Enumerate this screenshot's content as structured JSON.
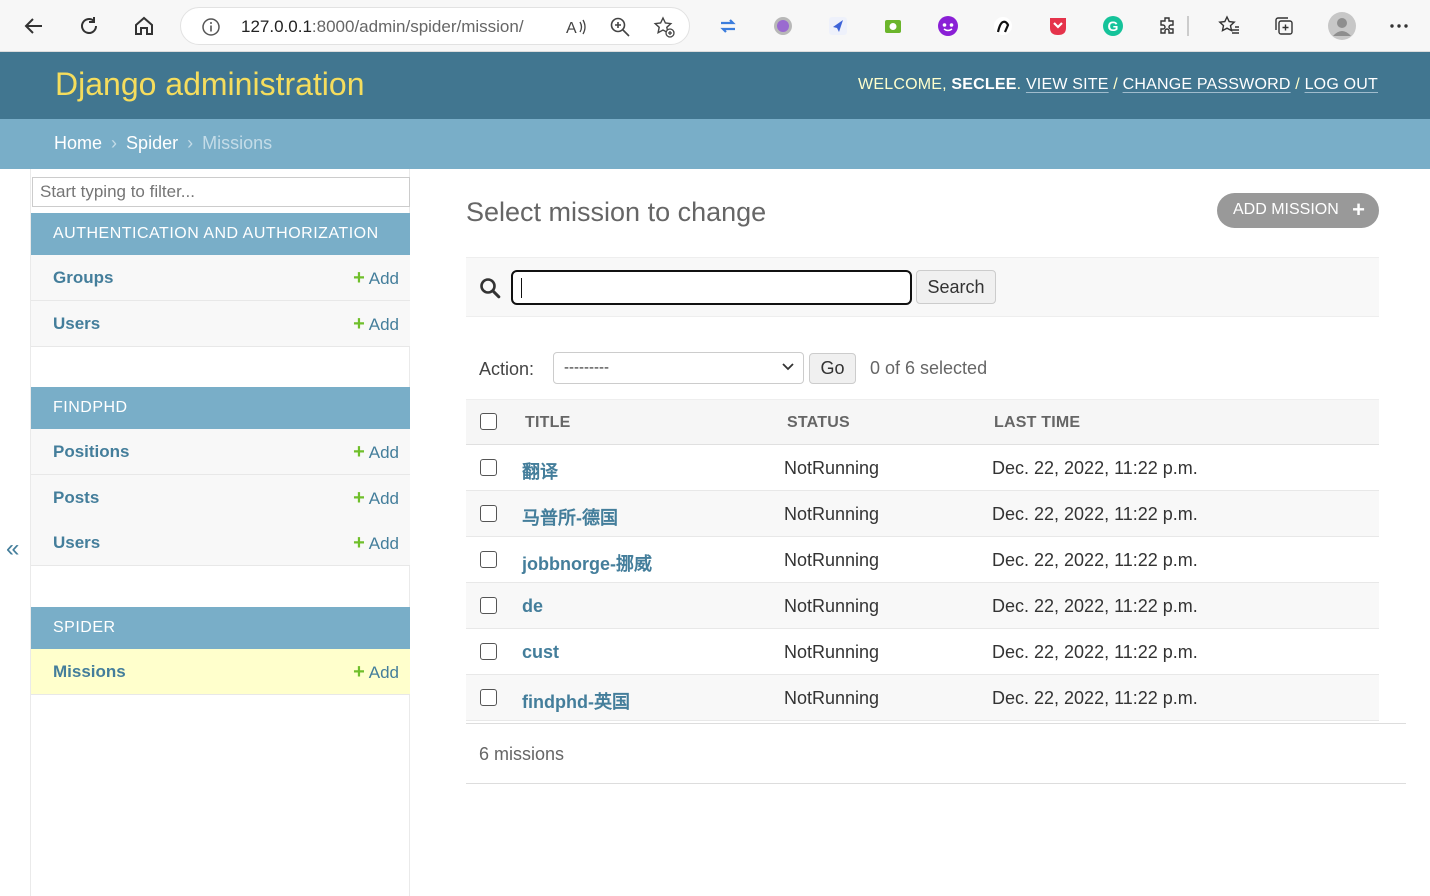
{
  "browser": {
    "url_host": "127.0.0.1",
    "url_path": ":8000/admin/spider/mission/"
  },
  "header": {
    "site_name": "Django administration",
    "welcome": "WELCOME, ",
    "username": "SECLEE",
    "view_site": "VIEW SITE",
    "change_password": "CHANGE PASSWORD",
    "log_out": "LOG OUT",
    "sep": " / "
  },
  "breadcrumbs": {
    "home": "Home",
    "app": "Spider",
    "current": "Missions",
    "sep": "›"
  },
  "sidebar": {
    "filter_placeholder": "Start typing to filter...",
    "toggle": "«",
    "add_label": "Add",
    "apps": [
      {
        "caption": "AUTHENTICATION AND AUTHORIZATION",
        "models": [
          "Groups",
          "Users"
        ]
      },
      {
        "caption": "FINDPHD",
        "models": [
          "Positions",
          "Posts",
          "Users"
        ]
      },
      {
        "caption": "SPIDER",
        "models": [
          "Missions"
        ]
      }
    ]
  },
  "content": {
    "title": "Select mission to change",
    "add_button": "ADD MISSION",
    "search_button": "Search",
    "search_value": "",
    "action_label": "Action:",
    "action_selected": "---------",
    "go_button": "Go",
    "action_counter": "0 of 6 selected",
    "columns": [
      "TITLE",
      "STATUS",
      "LAST TIME"
    ],
    "rows": [
      {
        "title": "翻译",
        "status": "NotRunning",
        "last_time": "Dec. 22, 2022, 11:22 p.m."
      },
      {
        "title": "马普所-德国",
        "status": "NotRunning",
        "last_time": "Dec. 22, 2022, 11:22 p.m."
      },
      {
        "title": "jobbnorge-挪威",
        "status": "NotRunning",
        "last_time": "Dec. 22, 2022, 11:22 p.m."
      },
      {
        "title": "de",
        "status": "NotRunning",
        "last_time": "Dec. 22, 2022, 11:22 p.m."
      },
      {
        "title": "cust",
        "status": "NotRunning",
        "last_time": "Dec. 22, 2022, 11:22 p.m."
      },
      {
        "title": "findphd-英国",
        "status": "NotRunning",
        "last_time": "Dec. 22, 2022, 11:22 p.m."
      }
    ],
    "paginator": "6 missions"
  },
  "colors": {
    "header_bg": "#417690",
    "breadcrumb_bg": "#79aec8",
    "branding": "#f5dd5d",
    "link": "#447e9b",
    "add_plus": "#70bf2b",
    "current_row": "#ffffcc"
  },
  "icons": {
    "back": "back-arrow-icon",
    "refresh": "refresh-icon",
    "home": "home-icon",
    "search": "search-icon",
    "add": "plus-icon"
  }
}
